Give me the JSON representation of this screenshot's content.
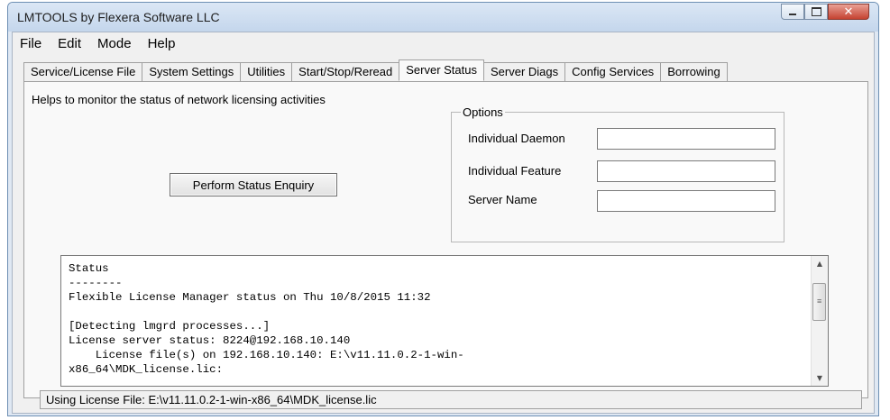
{
  "window": {
    "title": "LMTOOLS by Flexera Software LLC"
  },
  "menu": [
    "File",
    "Edit",
    "Mode",
    "Help"
  ],
  "tabs": [
    {
      "label": "Service/License File",
      "active": false
    },
    {
      "label": "System Settings",
      "active": false
    },
    {
      "label": "Utilities",
      "active": false
    },
    {
      "label": "Start/Stop/Reread",
      "active": false
    },
    {
      "label": "Server Status",
      "active": true
    },
    {
      "label": "Server Diags",
      "active": false
    },
    {
      "label": "Config Services",
      "active": false
    },
    {
      "label": "Borrowing",
      "active": false
    }
  ],
  "panel": {
    "help_text": "Helps to monitor the status of network licensing activities",
    "perform_button": "Perform Status Enquiry",
    "options": {
      "legend": "Options",
      "individual_daemon_label": "Individual Daemon",
      "individual_daemon_value": "",
      "individual_feature_label": "Individual Feature",
      "individual_feature_value": "",
      "server_name_label": "Server Name",
      "server_name_value": ""
    },
    "status_lines": [
      "Status",
      "--------",
      "Flexible License Manager status on Thu 10/8/2015 11:32",
      "",
      "[Detecting lmgrd processes...]",
      "License server status: 8224@192.168.10.140",
      "    License file(s) on 192.168.10.140: E:\\v11.11.0.2-1-win-",
      "x86_64\\MDK_license.lic:"
    ]
  },
  "statusbar": {
    "text": "Using License File:  E:\\v11.11.0.2-1-win-x86_64\\MDK_license.lic"
  },
  "colors": {
    "title_bar": "#c4d6ec",
    "close_button": "#c54231",
    "face": "#f0f0f0"
  }
}
